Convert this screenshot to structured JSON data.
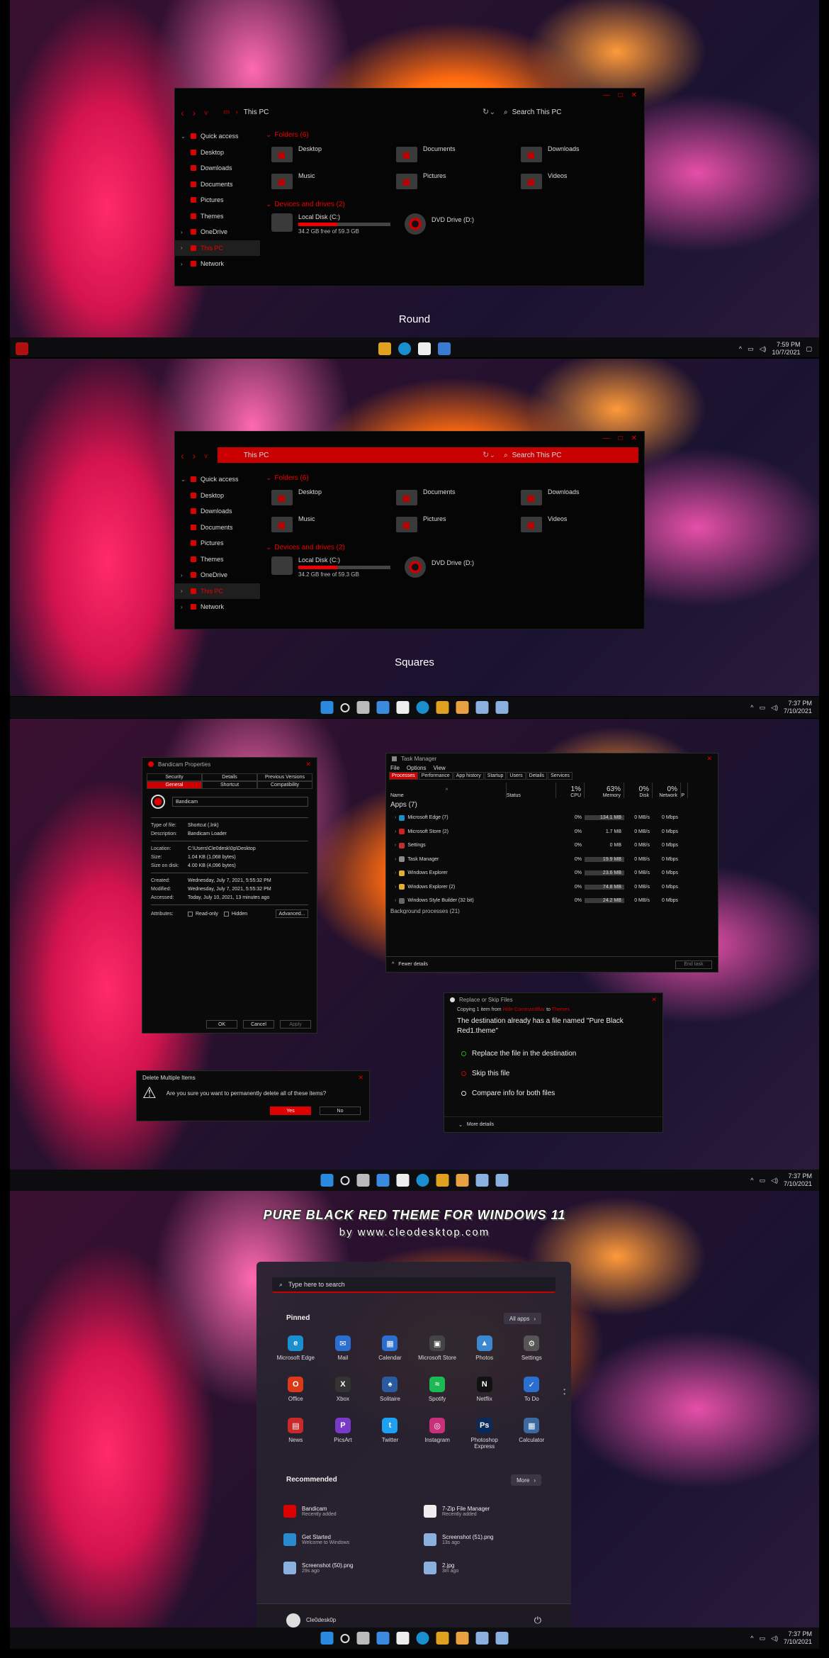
{
  "explorer": {
    "address": "This PC",
    "search_placeholder": "Search This PC",
    "sidebar": [
      {
        "label": "Quick access",
        "chev": "v",
        "sub": false,
        "active": false
      },
      {
        "label": "Desktop",
        "sub": true
      },
      {
        "label": "Downloads",
        "sub": true
      },
      {
        "label": "Documents",
        "sub": true
      },
      {
        "label": "Pictures",
        "sub": true
      },
      {
        "label": "Themes",
        "sub": true
      },
      {
        "label": "OneDrive",
        "chev": ">",
        "sub": false
      },
      {
        "label": "This PC",
        "chev": ">",
        "sub": false,
        "active": true
      },
      {
        "label": "Network",
        "chev": ">",
        "sub": false
      }
    ],
    "folders_header": "Folders (6)",
    "folders": [
      "Desktop",
      "Documents",
      "Downloads",
      "Music",
      "Pictures",
      "Videos"
    ],
    "drives_header": "Devices and drives (2)",
    "drive_c": {
      "name": "Local Disk (C:)",
      "free": "34.2 GB free of 59.3 GB",
      "used_fraction": 0.42
    },
    "drive_d": {
      "name": "DVD Drive (D:)"
    }
  },
  "captions": {
    "round": "Round",
    "squares": "Squares"
  },
  "taskbar1": {
    "time": "7:59 PM",
    "date": "10/7/2021"
  },
  "taskbar": {
    "time": "7:37 PM",
    "date": "7/10/2021"
  },
  "properties": {
    "title": "Bandicam Properties",
    "tabs_top": [
      "Security",
      "Details",
      "Previous Versions"
    ],
    "tabs_bottom": [
      "General",
      "Shortcut",
      "Compatibility"
    ],
    "name": "Bandicam",
    "rows1": [
      [
        "Type of file:",
        "Shortcut (.lnk)"
      ],
      [
        "Description:",
        "Bandicam Loader"
      ]
    ],
    "rows2": [
      [
        "Location:",
        "C:\\Users\\Cle0desk\\0p\\Desktop"
      ],
      [
        "Size:",
        "1.04 KB (1,068 bytes)"
      ],
      [
        "Size on disk:",
        "4.00 KB (4,096 bytes)"
      ]
    ],
    "rows3": [
      [
        "Created:",
        "Wednesday, July 7, 2021, 5:55:32 PM"
      ],
      [
        "Modified:",
        "Wednesday, July 7, 2021, 5:55:32 PM"
      ],
      [
        "Accessed:",
        "Today, July 10, 2021, 13 minutes ago"
      ]
    ],
    "attributes_label": "Attributes:",
    "readonly": "Read-only",
    "hidden": "Hidden",
    "advanced": "Advanced...",
    "ok": "OK",
    "cancel": "Cancel",
    "apply": "Apply"
  },
  "taskmanager": {
    "title": "Task Manager",
    "menu": [
      "File",
      "Options",
      "View"
    ],
    "tabs": [
      "Processes",
      "Performance",
      "App history",
      "Startup",
      "Users",
      "Details",
      "Services"
    ],
    "head": {
      "name": "Name",
      "status": "Status",
      "cpu_pct": "1%",
      "cpu": "CPU",
      "mem_pct": "63%",
      "mem": "Memory",
      "disk_pct": "0%",
      "disk": "Disk",
      "net_pct": "0%",
      "net": "Network",
      "pw": "P"
    },
    "group": "Apps (7)",
    "rows": [
      {
        "name": "Microsoft Edge (7)",
        "cpu": "0%",
        "mem": "134.1 MB",
        "disk": "0 MB/s",
        "net": "0 Mbps",
        "color": "#1e90c8"
      },
      {
        "name": "Microsoft Store (2)",
        "cpu": "0%",
        "mem": "1.7 MB",
        "disk": "0 MB/s",
        "net": "0 Mbps",
        "color": "#d02020"
      },
      {
        "name": "Settings",
        "cpu": "0%",
        "mem": "0 MB",
        "disk": "0 MB/s",
        "net": "0 Mbps",
        "color": "#c03030"
      },
      {
        "name": "Task Manager",
        "cpu": "0%",
        "mem": "19.9 MB",
        "disk": "0 MB/s",
        "net": "0 Mbps",
        "color": "#8a8a8a"
      },
      {
        "name": "Windows Explorer",
        "cpu": "0%",
        "mem": "23.6 MB",
        "disk": "0 MB/s",
        "net": "0 Mbps",
        "color": "#e0b030"
      },
      {
        "name": "Windows Explorer (2)",
        "cpu": "0%",
        "mem": "74.8 MB",
        "disk": "0 MB/s",
        "net": "0 Mbps",
        "color": "#e0b030"
      },
      {
        "name": "Windows Style Builder (32 bit)",
        "cpu": "0%",
        "mem": "24.2 MB",
        "disk": "0 MB/s",
        "net": "0 Mbps",
        "color": "#666"
      }
    ],
    "bg_group": "Background processes (21)",
    "fewer": "Fewer details",
    "end_task": "End task"
  },
  "replace": {
    "title": "Replace or Skip Files",
    "copying_pre": "Copying 1 item from",
    "from": "Hide CommandBar",
    "to_word": "to",
    "to": "Themes",
    "message": "The destination already has a file named \"Pure Black Red1.theme\"",
    "options": [
      "Replace the file in the destination",
      "Skip this file",
      "Compare info for both files"
    ],
    "more": "More details"
  },
  "delete": {
    "title": "Delete Multiple Items",
    "message": "Are you sure you want to permanently delete all of these items?",
    "yes": "Yes",
    "no": "No"
  },
  "start": {
    "heading": "PURE BLACK RED THEME FOR WINDOWS 11",
    "sub": "by www.cleodesktop.com",
    "search_placeholder": "Type here to search",
    "pinned": "Pinned",
    "all_apps": "All apps",
    "pins": [
      {
        "label": "Microsoft Edge",
        "color": "#1a8fd0",
        "glyph": "e"
      },
      {
        "label": "Mail",
        "color": "#2a6fd0",
        "glyph": "✉"
      },
      {
        "label": "Calendar",
        "color": "#2a6fd0",
        "glyph": "▦"
      },
      {
        "label": "Microsoft Store",
        "color": "#444",
        "glyph": "▣"
      },
      {
        "label": "Photos",
        "color": "#3a88d0",
        "glyph": "▲"
      },
      {
        "label": "Settings",
        "color": "#555",
        "glyph": "⚙"
      },
      {
        "label": "Office",
        "color": "#d83a1a",
        "glyph": "O"
      },
      {
        "label": "Xbox",
        "color": "#333",
        "glyph": "X"
      },
      {
        "label": "Solitaire",
        "color": "#2a5aa0",
        "glyph": "♠"
      },
      {
        "label": "Spotify",
        "color": "#1db954",
        "glyph": "≈"
      },
      {
        "label": "Netflix",
        "color": "#111",
        "glyph": "N"
      },
      {
        "label": "To Do",
        "color": "#2a6fd0",
        "glyph": "✓"
      },
      {
        "label": "News",
        "color": "#c82a2a",
        "glyph": "▤"
      },
      {
        "label": "PicsArt",
        "color": "#7a3ac8",
        "glyph": "P"
      },
      {
        "label": "Twitter",
        "color": "#1da1f2",
        "glyph": "t"
      },
      {
        "label": "Instagram",
        "color": "#c8307a",
        "glyph": "◎"
      },
      {
        "label": "Photoshop Express",
        "color": "#0a2a5a",
        "glyph": "Ps"
      },
      {
        "label": "Calculator",
        "color": "#3a6aa0",
        "glyph": "▦"
      }
    ],
    "recommended": "Recommended",
    "more": "More",
    "recs": [
      {
        "title": "Bandicam",
        "sub": "Recently added",
        "color": "#d00"
      },
      {
        "title": "7-Zip File Manager",
        "sub": "Recently added",
        "color": "#eee"
      },
      {
        "title": "Get Started",
        "sub": "Welcome to Windows",
        "color": "#2a8ad0"
      },
      {
        "title": "Screenshot (51).png",
        "sub": "13s ago",
        "color": "#8ab0e0"
      },
      {
        "title": "Screenshot (50).png",
        "sub": "29s ago",
        "color": "#8ab0e0"
      },
      {
        "title": "2.jpg",
        "sub": "3m ago",
        "color": "#8ab0e0"
      }
    ],
    "user": "Cle0desk0p"
  }
}
